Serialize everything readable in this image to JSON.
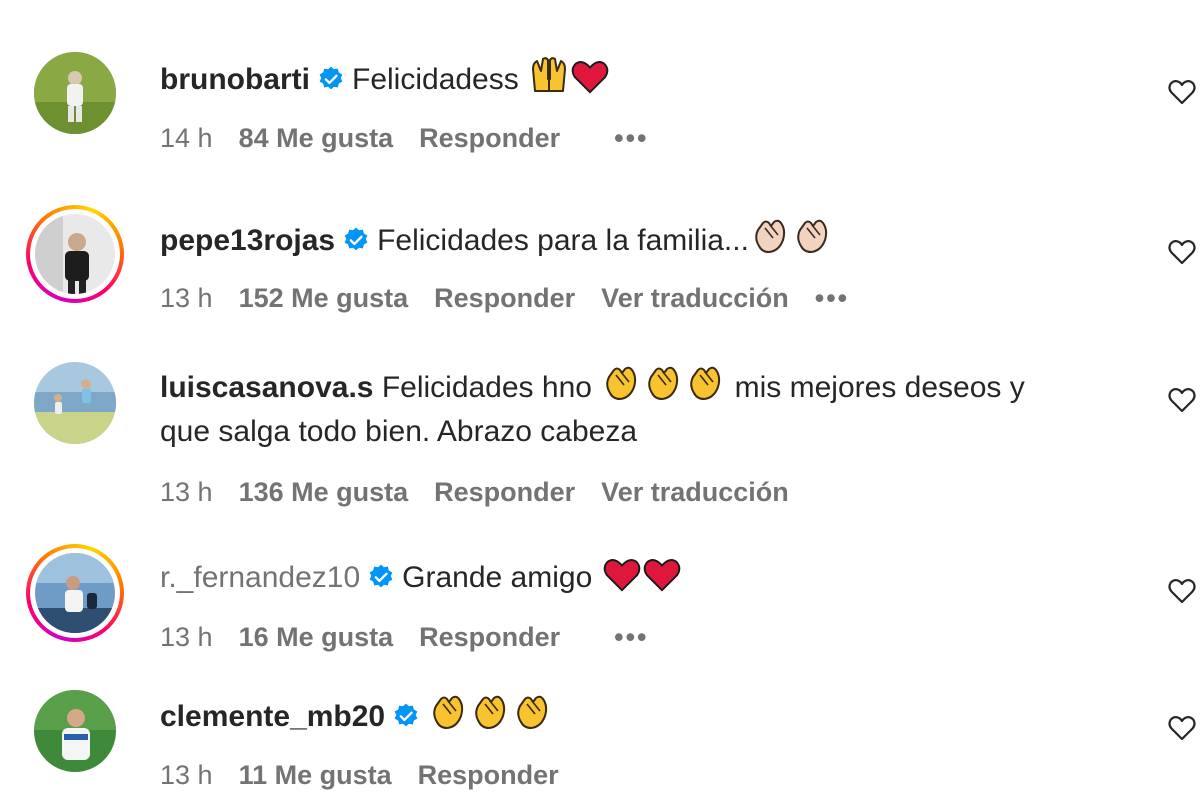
{
  "comments": [
    {
      "username": "brunobarti",
      "verified": true,
      "text": "Felicidadess",
      "emojis": [
        "raising-hands",
        "red-heart"
      ],
      "time": "14 h",
      "likes": "84 Me gusta",
      "reply": "Responder",
      "translate": "",
      "more": "•••"
    },
    {
      "username": "pepe13rojas",
      "verified": true,
      "text": "Felicidades para la familia...",
      "emojis": [
        "clapping-hands",
        "clapping-hands"
      ],
      "time": "13 h",
      "likes": "152 Me gusta",
      "reply": "Responder",
      "translate": "Ver traducción",
      "more": "•••"
    },
    {
      "username": "luiscasanova.s",
      "verified": false,
      "text": "Felicidades hno",
      "text_after_emojis": "mis mejores deseos y",
      "text_line2": "que salga todo bien. Abrazo cabeza",
      "emojis": [
        "clapping-hands",
        "clapping-hands",
        "clapping-hands"
      ],
      "time": "13 h",
      "likes": "136 Me gusta",
      "reply": "Responder",
      "translate": "Ver traducción",
      "more": ""
    },
    {
      "username": "r._fernandez10",
      "verified": true,
      "text": "Grande amigo",
      "emojis": [
        "red-heart",
        "red-heart"
      ],
      "time": "13 h",
      "likes": "16 Me gusta",
      "reply": "Responder",
      "translate": "",
      "more": "•••"
    },
    {
      "username": "clemente_mb20",
      "verified": true,
      "text": "",
      "emojis": [
        "clapping-hands",
        "clapping-hands",
        "clapping-hands"
      ],
      "time": "13 h",
      "likes": "11 Me gusta",
      "reply": "Responder",
      "translate": "",
      "more": ""
    }
  ],
  "colors": {
    "text": "#262626",
    "secondary": "#737373",
    "verified_blue": "#0095f6",
    "heart_red": "#e0173d",
    "clap_yellow": "#f7c331"
  }
}
